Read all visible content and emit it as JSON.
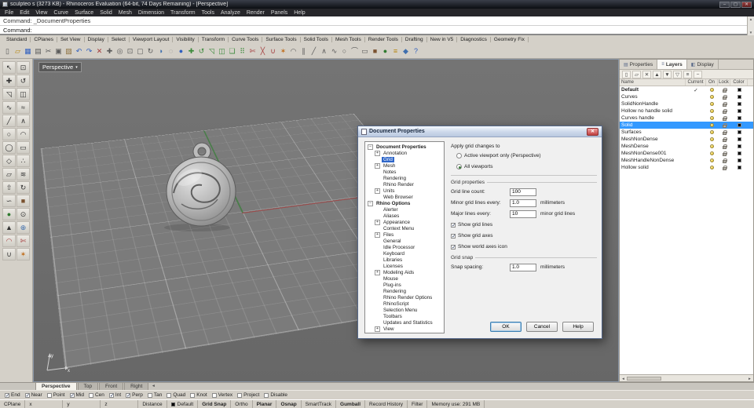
{
  "ui": {
    "check": "✓",
    "scroll_up": "▲",
    "scroll_down": "▼",
    "arrow_left": "◄",
    "arrow_right": "►",
    "dropdown": "▾",
    "close": "✕",
    "min": "–",
    "max": "▢"
  },
  "colors": {
    "selection": "#3399ff",
    "viewport_bg": "#6d6d6d",
    "grid_plane": "#7b7b7b",
    "axis_x": "#9a4a4a",
    "axis_y": "#4a7d4a",
    "layer_default": "#000000"
  },
  "window": {
    "title": "sculpteo s (3273 KB) - Rhinoceros Evaluation (64-bit, 74 Days Remaining) - [Perspective]",
    "menus": [
      "File",
      "Edit",
      "View",
      "Curve",
      "Surface",
      "Solid",
      "Mesh",
      "Dimension",
      "Transform",
      "Tools",
      "Analyze",
      "Render",
      "Panels",
      "Help"
    ]
  },
  "command": {
    "history": "Command: _DocumentProperties",
    "prompt": "Command:"
  },
  "toolbar_tabs": [
    "Standard",
    "CPlanes",
    "Set View",
    "Display",
    "Select",
    "Viewport Layout",
    "Visibility",
    "Transform",
    "Curve Tools",
    "Surface Tools",
    "Solid Tools",
    "Mesh Tools",
    "Render Tools",
    "Drafting",
    "New in V5",
    "Diagnostics",
    "Geometry Fix"
  ],
  "top_icons": [
    {
      "name": "new-file",
      "glyph": "▯",
      "color": "#5a5a5a"
    },
    {
      "name": "open-file",
      "glyph": "▱",
      "color": "#b8860b"
    },
    {
      "name": "save-file",
      "glyph": "▦",
      "color": "#2f5fbf"
    },
    {
      "name": "print",
      "glyph": "▤",
      "color": "#5a5a5a"
    },
    {
      "name": "cut",
      "glyph": "✂",
      "color": "#5a5a5a"
    },
    {
      "name": "copy",
      "glyph": "▣",
      "color": "#5a5a5a"
    },
    {
      "name": "paste",
      "glyph": "▨",
      "color": "#8a6d3b"
    },
    {
      "name": "undo",
      "glyph": "↶",
      "color": "#2f5fbf"
    },
    {
      "name": "redo",
      "glyph": "↷",
      "color": "#2f5fbf"
    },
    {
      "name": "delete",
      "glyph": "✕",
      "color": "#a33a3a"
    },
    {
      "name": "pan-view",
      "glyph": "✚",
      "color": "#5a5a5a"
    },
    {
      "name": "zoom-dynamic",
      "glyph": "◎",
      "color": "#5a5a5a"
    },
    {
      "name": "zoom-window",
      "glyph": "⊡",
      "color": "#5a5a5a"
    },
    {
      "name": "zoom-extents",
      "glyph": "▢",
      "color": "#5a5a5a"
    },
    {
      "name": "rotate-view",
      "glyph": "↻",
      "color": "#5a5a5a"
    },
    {
      "name": "shaded-viewport",
      "glyph": "◑",
      "color": "#3f6fae"
    },
    {
      "name": "wireframe-viewport",
      "glyph": "◌",
      "color": "#777777"
    },
    {
      "name": "render",
      "glyph": "●",
      "color": "#2f5fbf"
    },
    {
      "name": "move",
      "glyph": "✚",
      "color": "#3a8a3a"
    },
    {
      "name": "rotate",
      "glyph": "↺",
      "color": "#3a8a3a"
    },
    {
      "name": "scale",
      "glyph": "◹",
      "color": "#3a8a3a"
    },
    {
      "name": "mirror",
      "glyph": "◫",
      "color": "#3a8a3a"
    },
    {
      "name": "copy-object",
      "glyph": "❏",
      "color": "#3a8a3a"
    },
    {
      "name": "array",
      "glyph": "⠿",
      "color": "#3a8a3a"
    },
    {
      "name": "trim",
      "glyph": "✄",
      "color": "#a33a3a"
    },
    {
      "name": "split",
      "glyph": "╳",
      "color": "#a33a3a"
    },
    {
      "name": "join",
      "glyph": "∪",
      "color": "#a33a3a"
    },
    {
      "name": "explode",
      "glyph": "✶",
      "color": "#c07020"
    },
    {
      "name": "fillet",
      "glyph": "◠",
      "color": "#5a5a5a"
    },
    {
      "name": "offset",
      "glyph": "∥",
      "color": "#5a5a5a"
    },
    {
      "name": "line",
      "glyph": "╱",
      "color": "#5a5a5a"
    },
    {
      "name": "polyline",
      "glyph": "∧",
      "color": "#5a5a5a"
    },
    {
      "name": "curve",
      "glyph": "∿",
      "color": "#5a5a5a"
    },
    {
      "name": "circle",
      "glyph": "○",
      "color": "#5a5a5a"
    },
    {
      "name": "arc",
      "glyph": "⌒",
      "color": "#5a5a5a"
    },
    {
      "name": "rectangle",
      "glyph": "▭",
      "color": "#5a5a5a"
    },
    {
      "name": "box",
      "glyph": "■",
      "color": "#7a5230"
    },
    {
      "name": "sphere",
      "glyph": "●",
      "color": "#2f7a2f"
    },
    {
      "name": "layers",
      "glyph": "≡",
      "color": "#b8860b"
    },
    {
      "name": "properties",
      "glyph": "◆",
      "color": "#3f6fae"
    },
    {
      "name": "help",
      "glyph": "?",
      "color": "#2f5fbf"
    }
  ],
  "side_icons": [
    {
      "name": "select-pointer",
      "glyph": "↖",
      "color": "#333333"
    },
    {
      "name": "select-window",
      "glyph": "⊡",
      "color": "#333333"
    },
    {
      "name": "move",
      "glyph": "✚",
      "color": "#333333"
    },
    {
      "name": "rotate",
      "glyph": "↺",
      "color": "#333333"
    },
    {
      "name": "scale",
      "glyph": "◹",
      "color": "#333333"
    },
    {
      "name": "mirror",
      "glyph": "◫",
      "color": "#333333"
    },
    {
      "name": "curve",
      "glyph": "∿",
      "color": "#333333"
    },
    {
      "name": "interpolate-curve",
      "glyph": "≈",
      "color": "#333333"
    },
    {
      "name": "line",
      "glyph": "╱",
      "color": "#333333"
    },
    {
      "name": "polyline",
      "glyph": "∧",
      "color": "#333333"
    },
    {
      "name": "circle",
      "glyph": "○",
      "color": "#333333"
    },
    {
      "name": "arc",
      "glyph": "◠",
      "color": "#333333"
    },
    {
      "name": "ellipse",
      "glyph": "◯",
      "color": "#333333"
    },
    {
      "name": "rectangle",
      "glyph": "▭",
      "color": "#333333"
    },
    {
      "name": "polygon",
      "glyph": "◇",
      "color": "#333333"
    },
    {
      "name": "point",
      "glyph": "∴",
      "color": "#333333"
    },
    {
      "name": "surface",
      "glyph": "▱",
      "color": "#333333"
    },
    {
      "name": "loft",
      "glyph": "≋",
      "color": "#333333"
    },
    {
      "name": "extrude",
      "glyph": "⇧",
      "color": "#333333"
    },
    {
      "name": "revolve",
      "glyph": "↻",
      "color": "#333333"
    },
    {
      "name": "sweep",
      "glyph": "∽",
      "color": "#333333"
    },
    {
      "name": "box",
      "glyph": "■",
      "color": "#7a5230"
    },
    {
      "name": "sphere",
      "glyph": "●",
      "color": "#2f7a2f"
    },
    {
      "name": "cylinder",
      "glyph": "⊙",
      "color": "#333333"
    },
    {
      "name": "cone",
      "glyph": "▲",
      "color": "#333333"
    },
    {
      "name": "boolean-union",
      "glyph": "⊕",
      "color": "#3f6fae"
    },
    {
      "name": "fillet-edge",
      "glyph": "◠",
      "color": "#a33a3a"
    },
    {
      "name": "trim",
      "glyph": "✄",
      "color": "#a33a3a"
    },
    {
      "name": "join",
      "glyph": "∪",
      "color": "#333333"
    },
    {
      "name": "explode",
      "glyph": "✶",
      "color": "#c07020"
    }
  ],
  "viewport": {
    "label": "Perspective",
    "axis_labels": {
      "x": "x",
      "y": "y"
    },
    "tabs": [
      {
        "label": "Perspective",
        "active": true
      },
      {
        "label": "Top",
        "active": false
      },
      {
        "label": "Front",
        "active": false
      },
      {
        "label": "Right",
        "active": false
      }
    ]
  },
  "dialog": {
    "title": "Document Properties",
    "tree": [
      {
        "label": "Document Properties",
        "expander": "−",
        "children": [
          {
            "label": "Annotation",
            "expander": "+"
          },
          {
            "label": "Grid",
            "selected": true
          },
          {
            "label": "Mesh",
            "expander": "+"
          },
          {
            "label": "Notes"
          },
          {
            "label": "Rendering"
          },
          {
            "label": "Rhino Render"
          },
          {
            "label": "Units",
            "expander": "+"
          },
          {
            "label": "Web Browser"
          }
        ]
      },
      {
        "label": "Rhino Options",
        "expander": "−",
        "children": [
          {
            "label": "Alerter"
          },
          {
            "label": "Aliases"
          },
          {
            "label": "Appearance",
            "expander": "+"
          },
          {
            "label": "Context Menu"
          },
          {
            "label": "Files",
            "expander": "+"
          },
          {
            "label": "General"
          },
          {
            "label": "Idle Processor"
          },
          {
            "label": "Keyboard"
          },
          {
            "label": "Libraries"
          },
          {
            "label": "Licenses"
          },
          {
            "label": "Modeling Aids",
            "expander": "+"
          },
          {
            "label": "Mouse"
          },
          {
            "label": "Plug-ins"
          },
          {
            "label": "Rendering"
          },
          {
            "label": "Rhino Render Options"
          },
          {
            "label": "RhinoScript"
          },
          {
            "label": "Selection Menu"
          },
          {
            "label": "Toolbars"
          },
          {
            "label": "Updates and Statistics"
          },
          {
            "label": "View",
            "expander": "+"
          }
        ]
      }
    ],
    "apply_section": {
      "label": "Apply grid changes to",
      "radios": [
        {
          "label": "Active viewport only (Perspective)",
          "selected": false
        },
        {
          "label": "All viewports",
          "selected": true
        }
      ]
    },
    "grid_properties": {
      "label": "Grid properties",
      "fields": [
        {
          "label": "Grid line count:",
          "value": "100",
          "unit": ""
        },
        {
          "label": "Minor grid lines every:",
          "value": "1.0",
          "unit": "millimeters"
        },
        {
          "label": "Major lines every:",
          "value": "10",
          "unit": "minor grid lines"
        }
      ],
      "checkboxes": [
        {
          "label": "Show grid lines",
          "checked": true
        },
        {
          "label": "Show grid axes",
          "checked": true
        },
        {
          "label": "Show world axes icon",
          "checked": true
        }
      ]
    },
    "grid_snap": {
      "label": "Grid snap",
      "fields": [
        {
          "label": "Snap spacing:",
          "value": "1.0",
          "unit": "millimeters"
        }
      ]
    },
    "buttons": [
      {
        "label": "OK",
        "primary": true
      },
      {
        "label": "Cancel",
        "primary": false
      },
      {
        "label": "Help",
        "primary": false
      }
    ]
  },
  "layers_panel": {
    "tabs": [
      {
        "label": "Properties",
        "icon": "▤",
        "active": false
      },
      {
        "label": "Layers",
        "icon": "≡",
        "active": true
      },
      {
        "label": "Display",
        "icon": "◧",
        "active": false
      }
    ],
    "toolbar_icons": [
      {
        "name": "new-layer",
        "glyph": "▯"
      },
      {
        "name": "new-sublayer",
        "glyph": "▱"
      },
      {
        "name": "delete-layer",
        "glyph": "✕"
      },
      {
        "name": "move-up",
        "glyph": "▲"
      },
      {
        "name": "move-down",
        "glyph": "▼"
      },
      {
        "name": "filter-layers",
        "glyph": "▽"
      },
      {
        "name": "layer-tools",
        "glyph": "≡"
      },
      {
        "name": "collapse-all",
        "glyph": "−"
      }
    ],
    "columns": [
      "Name",
      "Current",
      "On",
      "Lock",
      "Color"
    ],
    "rows": [
      {
        "name": "Default",
        "current": true,
        "selected": false,
        "color": "#000000"
      },
      {
        "name": "Curves",
        "current": false,
        "selected": false,
        "color": "#000000"
      },
      {
        "name": "SolidNonHandle",
        "current": false,
        "selected": false,
        "color": "#000000"
      },
      {
        "name": "Hollow no handle solid",
        "current": false,
        "selected": false,
        "color": "#000000"
      },
      {
        "name": "Curves handle",
        "current": false,
        "selected": false,
        "color": "#000000"
      },
      {
        "name": "Solid",
        "current": false,
        "selected": true,
        "color": "#000000"
      },
      {
        "name": "Surfaces",
        "current": false,
        "selected": false,
        "color": "#000000"
      },
      {
        "name": "MeshNonDense",
        "current": false,
        "selected": false,
        "color": "#000000"
      },
      {
        "name": "MeshDense",
        "current": false,
        "selected": false,
        "color": "#000000"
      },
      {
        "name": "MeshNonDense001",
        "current": false,
        "selected": false,
        "color": "#000000"
      },
      {
        "name": "MeshHandleNonDense",
        "current": false,
        "selected": false,
        "color": "#000000"
      },
      {
        "name": "Hollow solid",
        "current": false,
        "selected": false,
        "color": "#000000"
      }
    ]
  },
  "osnap": {
    "items": [
      {
        "label": "End",
        "checked": true
      },
      {
        "label": "Near",
        "checked": true
      },
      {
        "label": "Point",
        "checked": false
      },
      {
        "label": "Mid",
        "checked": true
      },
      {
        "label": "Cen",
        "checked": false
      },
      {
        "label": "Int",
        "checked": true
      },
      {
        "label": "Perp",
        "checked": true
      },
      {
        "label": "Tan",
        "checked": false
      },
      {
        "label": "Quad",
        "checked": false
      },
      {
        "label": "Knot",
        "checked": false
      },
      {
        "label": "Vertex",
        "checked": false
      },
      {
        "label": "Project",
        "checked": false
      },
      {
        "label": "Disable",
        "checked": false
      }
    ]
  },
  "status": {
    "cplane_label": "CPlane",
    "x_label": "x",
    "y_label": "y",
    "z_label": "z",
    "distance_label": "Distance",
    "layer_name": "Default",
    "toggles": [
      {
        "label": "Grid Snap",
        "active": true
      },
      {
        "label": "Ortho",
        "active": false
      },
      {
        "label": "Planar",
        "active": true
      },
      {
        "label": "Osnap",
        "active": true
      },
      {
        "label": "SmartTrack",
        "active": false
      },
      {
        "label": "Gumball",
        "active": true
      },
      {
        "label": "Record History",
        "active": false
      },
      {
        "label": "Filter",
        "active": false
      }
    ],
    "memory": "Memory use: 291 MB"
  }
}
